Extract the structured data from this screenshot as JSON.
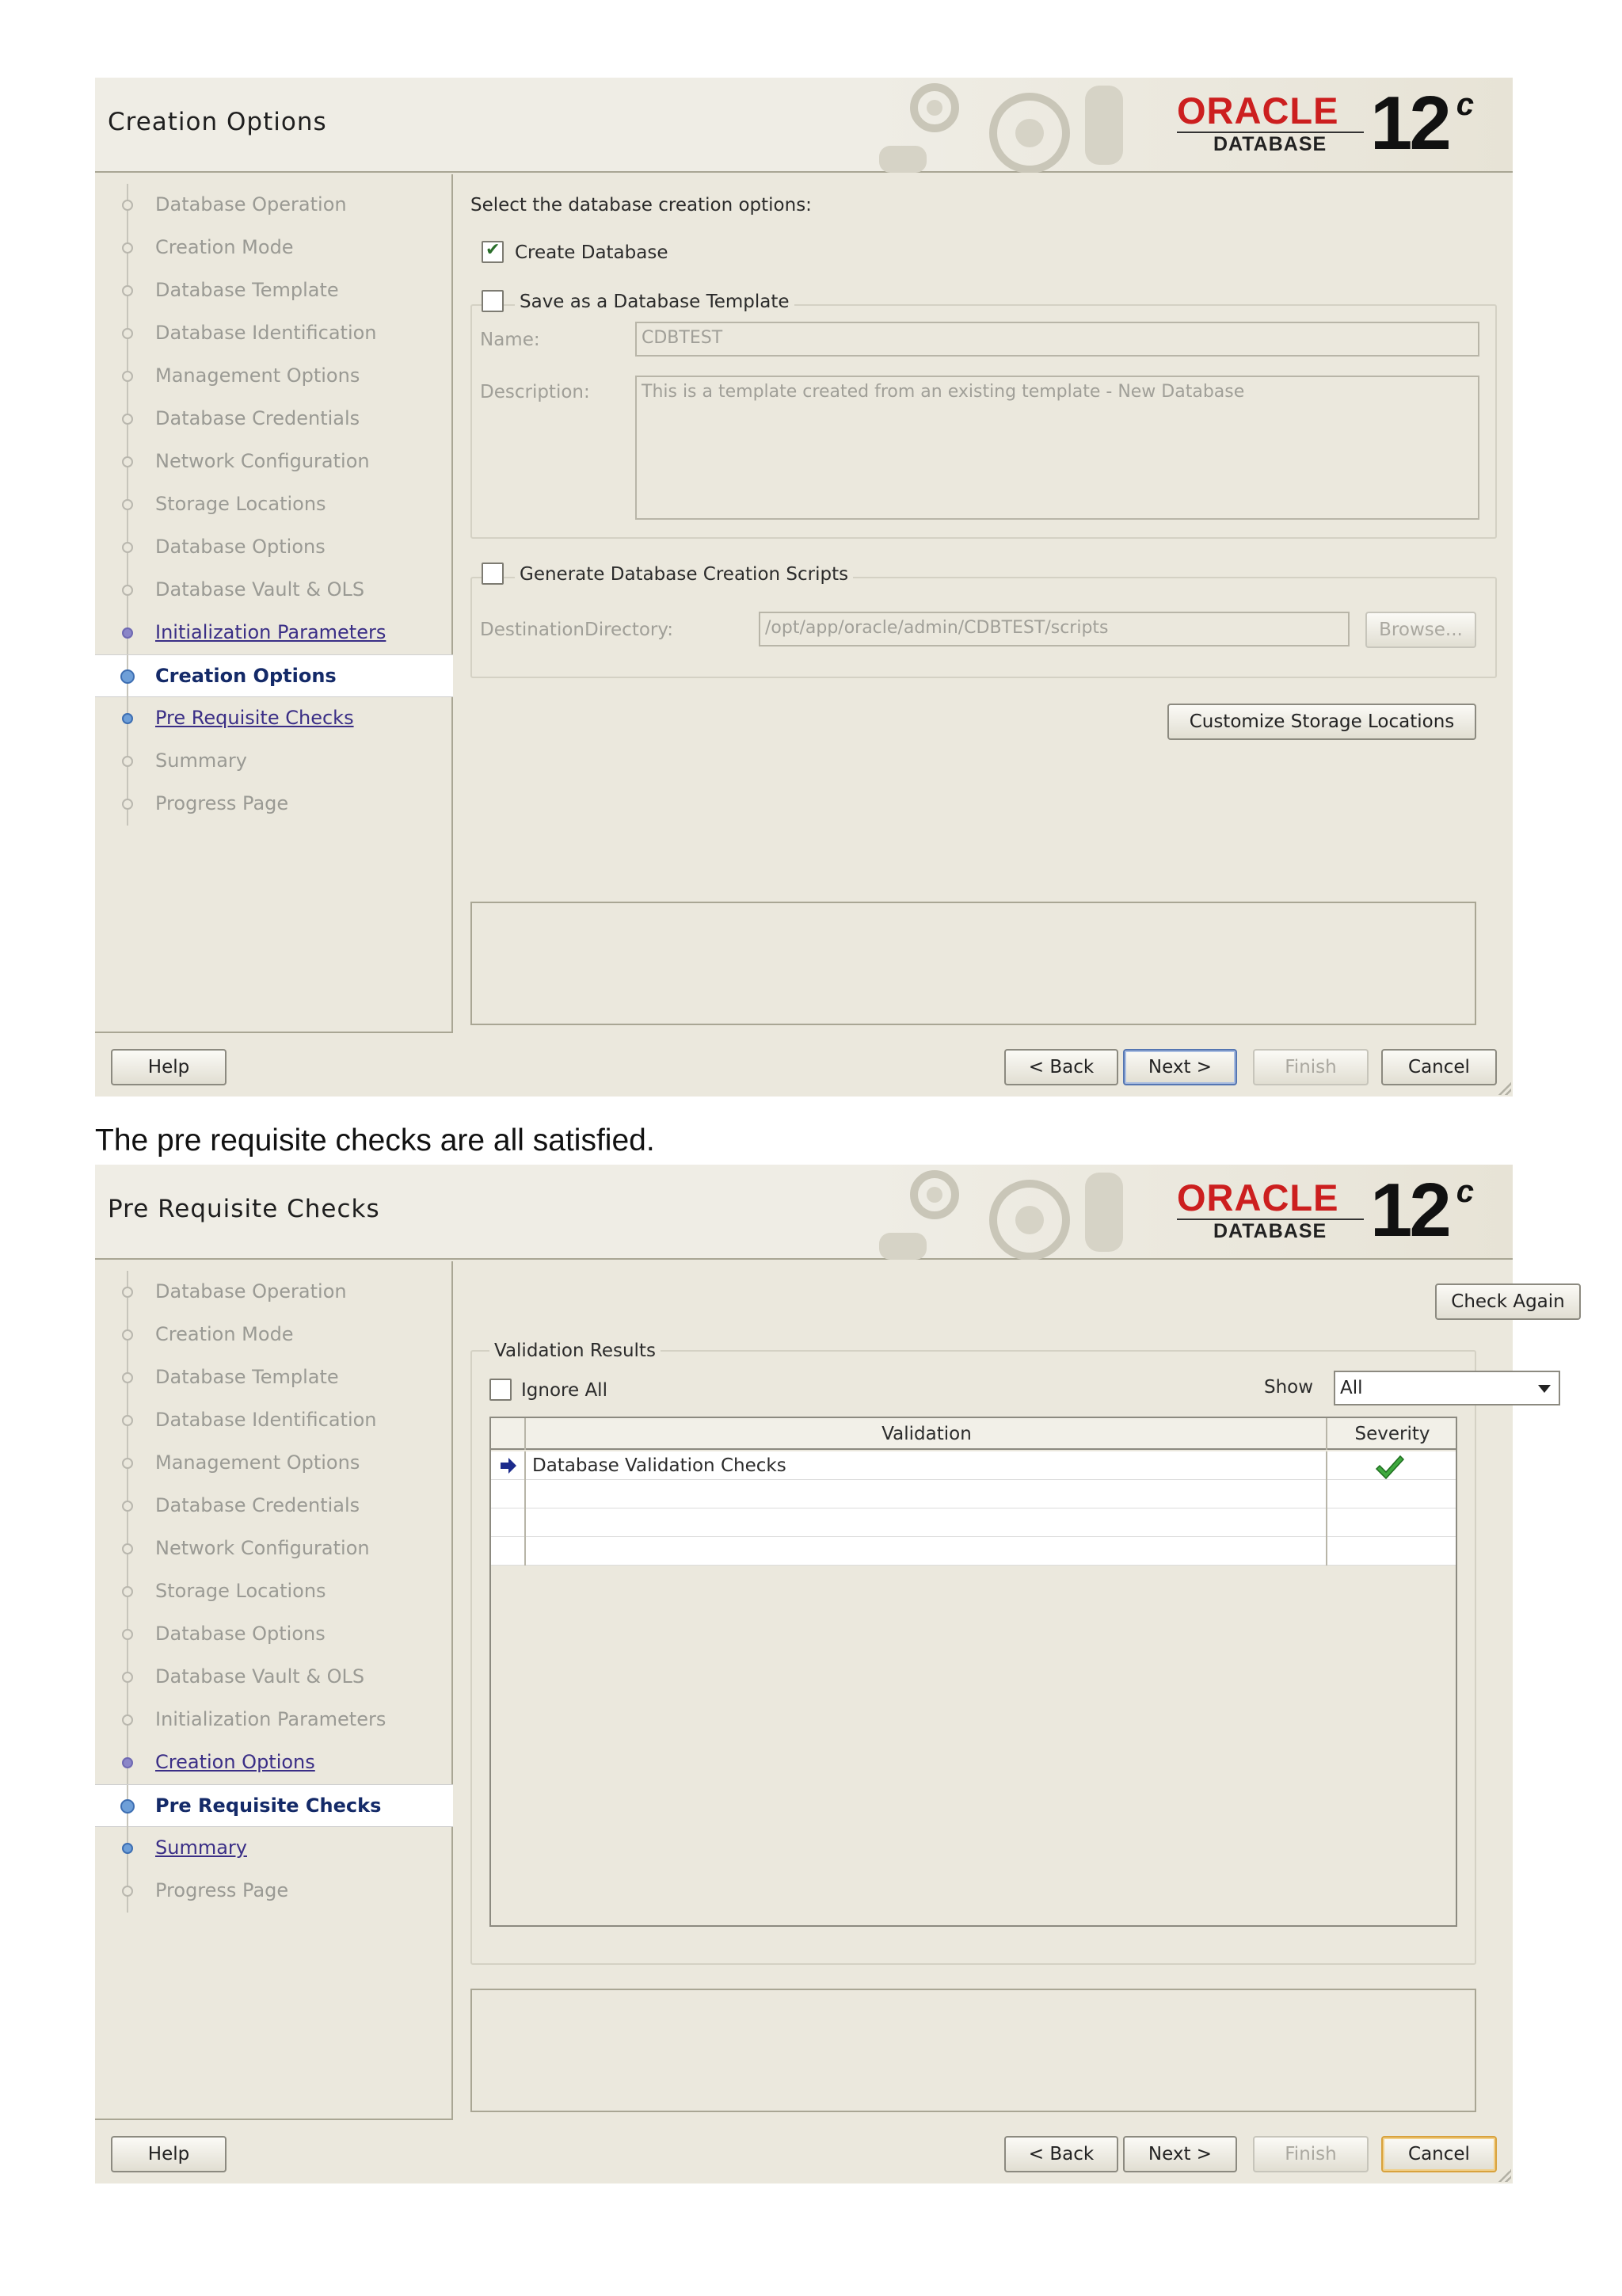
{
  "caption": "The pre requisite checks are all satisfied.",
  "brand": {
    "oracle": "ORACLE",
    "trademark": "®",
    "product": "DATABASE",
    "version": "12",
    "version_suffix": "c",
    "accent_color": "#cc1f1f"
  },
  "window1": {
    "title": "Creation Options",
    "steps": [
      {
        "label": "Database Operation",
        "state": "completed"
      },
      {
        "label": "Creation Mode",
        "state": "completed"
      },
      {
        "label": "Database Template",
        "state": "completed"
      },
      {
        "label": "Database Identification",
        "state": "completed"
      },
      {
        "label": "Management Options",
        "state": "completed"
      },
      {
        "label": "Database Credentials",
        "state": "completed"
      },
      {
        "label": "Network Configuration",
        "state": "completed"
      },
      {
        "label": "Storage Locations",
        "state": "completed"
      },
      {
        "label": "Database Options",
        "state": "completed"
      },
      {
        "label": "Database Vault & OLS",
        "state": "completed"
      },
      {
        "label": "Initialization Parameters",
        "state": "visited"
      },
      {
        "label": "Creation Options",
        "state": "current"
      },
      {
        "label": "Pre Requisite Checks",
        "state": "link"
      },
      {
        "label": "Summary",
        "state": "pending"
      },
      {
        "label": "Progress Page",
        "state": "pending"
      }
    ],
    "prompt": "Select the database creation options:",
    "create_database": {
      "label": "Create Database",
      "checked": true
    },
    "save_template": {
      "label": "Save as a Database Template",
      "checked": false
    },
    "name_label": "Name:",
    "name_value": "CDBTEST",
    "description_label": "Description:",
    "description_value": "This is a template created from an existing template - New Database",
    "generate_scripts": {
      "label": "Generate Database Creation Scripts",
      "checked": false
    },
    "destination_label": "DestinationDirectory:",
    "destination_value": "/opt/app/oracle/admin/CDBTEST/scripts",
    "browse_label": "Browse...",
    "customize_label": "Customize Storage Locations",
    "help_label": "Help",
    "back_label": "< Back",
    "next_label": "Next >",
    "finish_label": "Finish",
    "cancel_label": "Cancel"
  },
  "window2": {
    "title": "Pre Requisite Checks",
    "steps": [
      {
        "label": "Database Operation",
        "state": "completed"
      },
      {
        "label": "Creation Mode",
        "state": "completed"
      },
      {
        "label": "Database Template",
        "state": "completed"
      },
      {
        "label": "Database Identification",
        "state": "completed"
      },
      {
        "label": "Management Options",
        "state": "completed"
      },
      {
        "label": "Database Credentials",
        "state": "completed"
      },
      {
        "label": "Network Configuration",
        "state": "completed"
      },
      {
        "label": "Storage Locations",
        "state": "completed"
      },
      {
        "label": "Database Options",
        "state": "completed"
      },
      {
        "label": "Database Vault & OLS",
        "state": "completed"
      },
      {
        "label": "Initialization Parameters",
        "state": "completed"
      },
      {
        "label": "Creation Options",
        "state": "visited"
      },
      {
        "label": "Pre Requisite Checks",
        "state": "current"
      },
      {
        "label": "Summary",
        "state": "link"
      },
      {
        "label": "Progress Page",
        "state": "pending"
      }
    ],
    "check_again_label": "Check Again",
    "validation_group_label": "Validation Results",
    "ignore_all": {
      "label": "Ignore All",
      "checked": false
    },
    "show_label": "Show",
    "show_value": "All",
    "columns": [
      "Validation",
      "Severity"
    ],
    "rows": [
      {
        "validation": "Database Validation Checks",
        "severity": "passed"
      }
    ],
    "help_label": "Help",
    "back_label": "< Back",
    "next_label": "Next >",
    "finish_label": "Finish",
    "cancel_label": "Cancel"
  }
}
